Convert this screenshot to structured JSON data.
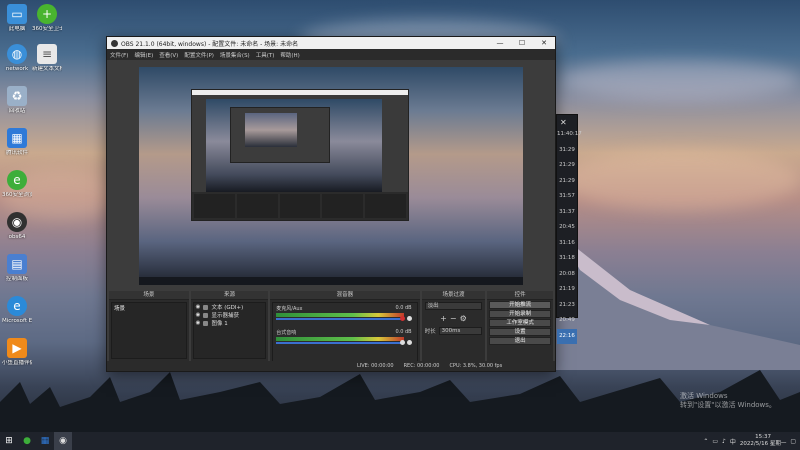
{
  "desktop": {
    "icons": [
      {
        "label": "此电脑",
        "icon": "computer-icon",
        "color": "#3a8fd8"
      },
      {
        "label": "360安全卫士",
        "icon": "360-security-icon",
        "color": "#49b42f"
      },
      {
        "label": "network",
        "icon": "network-icon",
        "color": "#3a8fd8"
      },
      {
        "label": "新建文本文档",
        "icon": "text-document-icon",
        "color": "#e8e8e8"
      },
      {
        "label": "回收站",
        "icon": "recycle-bin-icon",
        "color": "#9ab0c8"
      },
      {
        "label": "腾讯软件",
        "icon": "software-store-icon",
        "color": "#2f7ad8"
      },
      {
        "label": "360安全浏览器",
        "icon": "360-browser-icon",
        "color": "#3dae3a"
      },
      {
        "label": "obs64",
        "icon": "obs-icon",
        "color": "#303030"
      },
      {
        "label": "控制面板",
        "icon": "control-panel-icon",
        "color": "#4a7fd0"
      },
      {
        "label": "Microsoft Edge",
        "icon": "edge-icon",
        "color": "#2b8ad8"
      },
      {
        "label": "小鱼直播伴侣",
        "icon": "live-companion-icon",
        "color": "#f08a1a"
      }
    ]
  },
  "obs": {
    "title": "OBS 21.1.0 (64bit, windows) - 配置文件: 未命名 - 场景: 未命名",
    "menu": [
      "文件(F)",
      "编辑(E)",
      "查看(V)",
      "配置文件(P)",
      "场景集合(S)",
      "工具(T)",
      "帮助(H)"
    ],
    "docks": {
      "scenes": {
        "header": "场景",
        "items": [
          "场景"
        ]
      },
      "sources": {
        "header": "来源",
        "items": [
          "文本 (GDI+)",
          "显示器捕获",
          "图像 1"
        ]
      },
      "mixer": {
        "header": "混音器",
        "channels": [
          {
            "name": "麦克风/Aux",
            "db": "0.0 dB",
            "level": 0.92
          },
          {
            "name": "台式音响",
            "db": "0.0 dB",
            "level": 0.78
          }
        ]
      },
      "transitions": {
        "header": "场景过渡",
        "transition": "淡出",
        "duration_label": "时长",
        "duration": "300ms"
      },
      "controls": {
        "header": "控件",
        "buttons": [
          "开始推流",
          "开始录制",
          "工作室模式",
          "设置",
          "退出"
        ]
      }
    },
    "status": {
      "live": "LIVE: 00:00:00",
      "rec": "REC: 00:00:00",
      "cpu": "CPU: 3.8%, 30.00 fps"
    }
  },
  "timepanel": {
    "times": [
      "11:40:17",
      "31:29",
      "21:29",
      "21:29",
      "31:57",
      "31:37",
      "20:45",
      "31:16",
      "31:18",
      "20:08",
      "21:19",
      "21:23",
      "20:49",
      "22:16"
    ],
    "selected_index": 13
  },
  "taskbar": {
    "time": "15:37",
    "date": "2022/5/16 星期一"
  },
  "watermark": {
    "line1": "激活 Windows",
    "line2": "转到\"设置\"以激活 Windows。"
  }
}
